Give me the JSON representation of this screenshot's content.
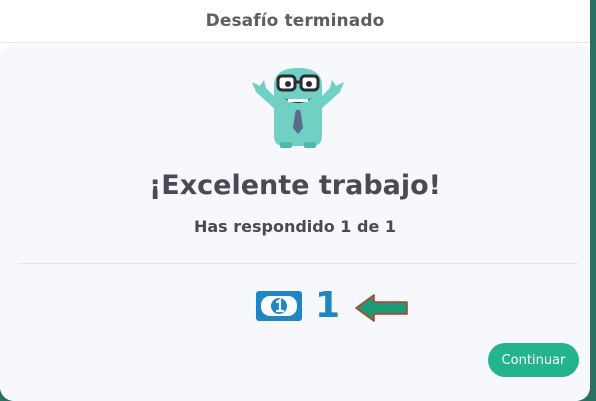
{
  "dialog": {
    "title": "Desafío terminado",
    "headline": "¡Excelente trabajo!",
    "result_text": "Has respondido 1 de 1",
    "reward": {
      "icon": "dollar-bill-icon",
      "count": "1"
    },
    "continue_label": "Continuar"
  },
  "colors": {
    "accent_green": "#23b38d",
    "reward_blue": "#1f86c6",
    "arrow_green": "#1d9b77",
    "arrow_outline": "#c0392b",
    "mascot_teal": "#6fd0c3"
  }
}
